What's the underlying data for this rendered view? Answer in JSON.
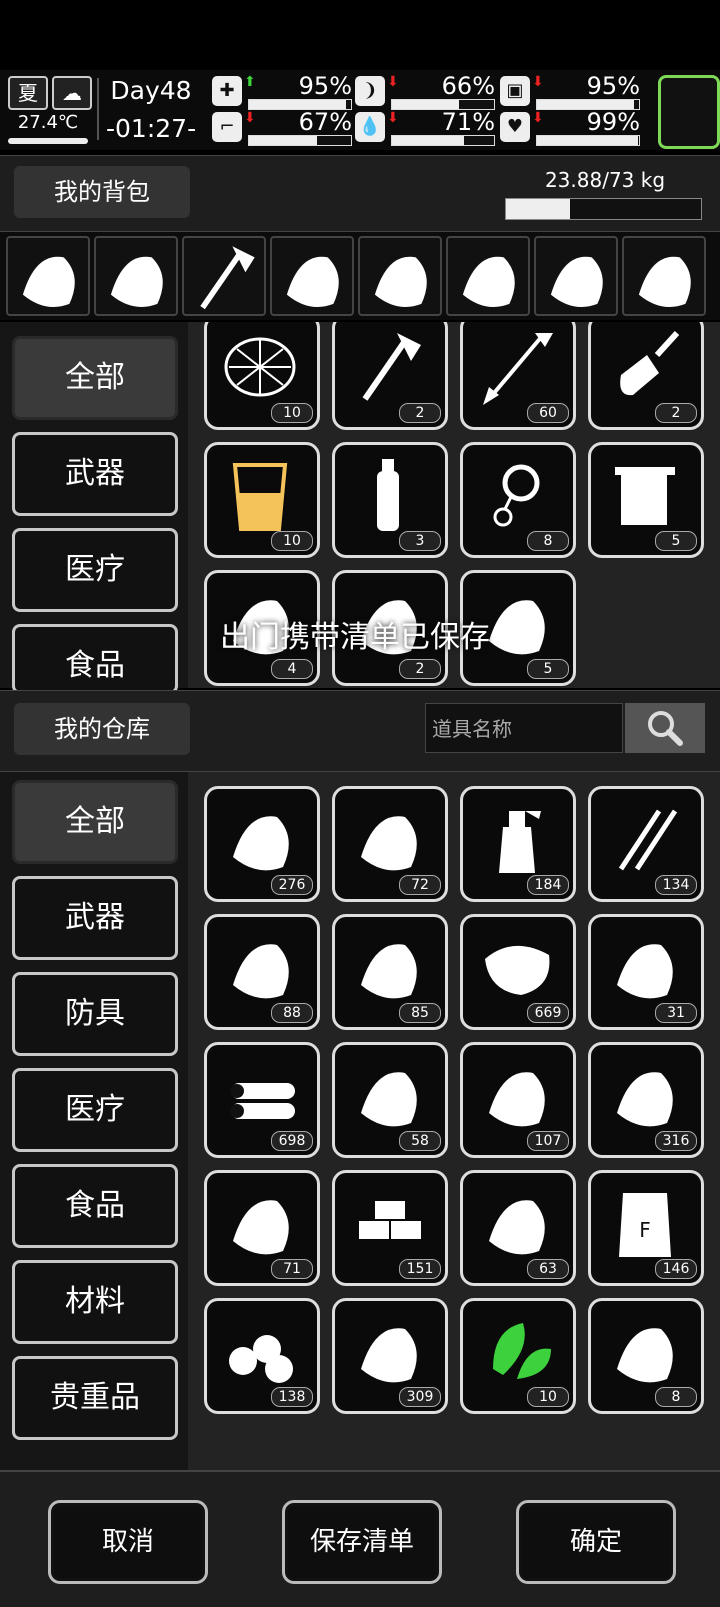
{
  "status": {
    "season": "夏",
    "temperature": "27.4℃",
    "day": "Day48",
    "time": "-01:27-",
    "stats": [
      {
        "icon": "medkit-icon",
        "glyph": "✚",
        "arrow": "up",
        "value": "95%",
        "fill": 0.95
      },
      {
        "icon": "stomach-icon",
        "glyph": "❩",
        "arrow": "down",
        "value": "66%",
        "fill": 0.66
      },
      {
        "icon": "pill-icon",
        "glyph": "▣",
        "arrow": "down",
        "value": "95%",
        "fill": 0.95
      },
      {
        "icon": "boot-icon",
        "glyph": "⌐",
        "arrow": "down",
        "value": "67%",
        "fill": 0.67
      },
      {
        "icon": "water-drop-icon",
        "glyph": "💧",
        "arrow": "down",
        "value": "71%",
        "fill": 0.71
      },
      {
        "icon": "heart-icon",
        "glyph": "♥",
        "arrow": "down",
        "value": "99%",
        "fill": 0.99
      }
    ]
  },
  "backpack": {
    "title": "我的背包",
    "weight": "23.88/73 kg",
    "weight_fill": 0.327,
    "equipment": [
      "net-helmet-icon",
      "pickaxe-hand-icon",
      "axe-icon",
      "riot-shield-icon",
      "glove-icon",
      "vest-armor-icon",
      "cap-icon",
      "backpack-icon"
    ],
    "categories": [
      "全部",
      "武器",
      "医疗",
      "食品"
    ],
    "items": [
      {
        "icon": "net-icon",
        "count": "10"
      },
      {
        "icon": "axe-icon",
        "count": "2"
      },
      {
        "icon": "arrow-icon",
        "count": "60"
      },
      {
        "icon": "shovel-icon",
        "count": "2"
      },
      {
        "icon": "cup-icon",
        "count": "10"
      },
      {
        "icon": "bottle-icon",
        "count": "3"
      },
      {
        "icon": "rope-icon",
        "count": "8"
      },
      {
        "icon": "towel-icon",
        "count": "5"
      },
      {
        "icon": "rice-icon",
        "count": "4"
      },
      {
        "icon": "bandage-icon",
        "count": "2"
      },
      {
        "icon": "skewer-icon",
        "count": "5"
      }
    ],
    "toast": "出门携带清单已保存"
  },
  "warehouse": {
    "title": "我的仓库",
    "search_placeholder": "道具名称",
    "categories": [
      "全部",
      "武器",
      "防具",
      "医疗",
      "食品",
      "材料",
      "贵重品"
    ],
    "items": [
      {
        "icon": "scrap-icon",
        "count": "276"
      },
      {
        "icon": "cloth-scrap-icon",
        "count": "72"
      },
      {
        "icon": "spray-bottle-icon",
        "count": "184"
      },
      {
        "icon": "nails-icon",
        "count": "134"
      },
      {
        "icon": "gravel-icon",
        "count": "88"
      },
      {
        "icon": "rock-icon",
        "count": "85"
      },
      {
        "icon": "meat-icon",
        "count": "669"
      },
      {
        "icon": "wire-icon",
        "count": "31"
      },
      {
        "icon": "logs-icon",
        "count": "698"
      },
      {
        "icon": "leather-icon",
        "count": "58"
      },
      {
        "icon": "fabric-icon",
        "count": "107"
      },
      {
        "icon": "cloth-pile-icon",
        "count": "316"
      },
      {
        "icon": "rag-shirt-icon",
        "count": "71"
      },
      {
        "icon": "bricks-icon",
        "count": "151"
      },
      {
        "icon": "seedling-icon",
        "count": "63"
      },
      {
        "icon": "flour-sack-icon",
        "count": "146"
      },
      {
        "icon": "potatoes-icon",
        "count": "138"
      },
      {
        "icon": "hay-icon",
        "count": "309"
      },
      {
        "icon": "herb-icon",
        "count": "10"
      },
      {
        "icon": "ginseng-icon",
        "count": "8"
      }
    ]
  },
  "footer": {
    "cancel": "取消",
    "save": "保存清单",
    "confirm": "确定"
  }
}
